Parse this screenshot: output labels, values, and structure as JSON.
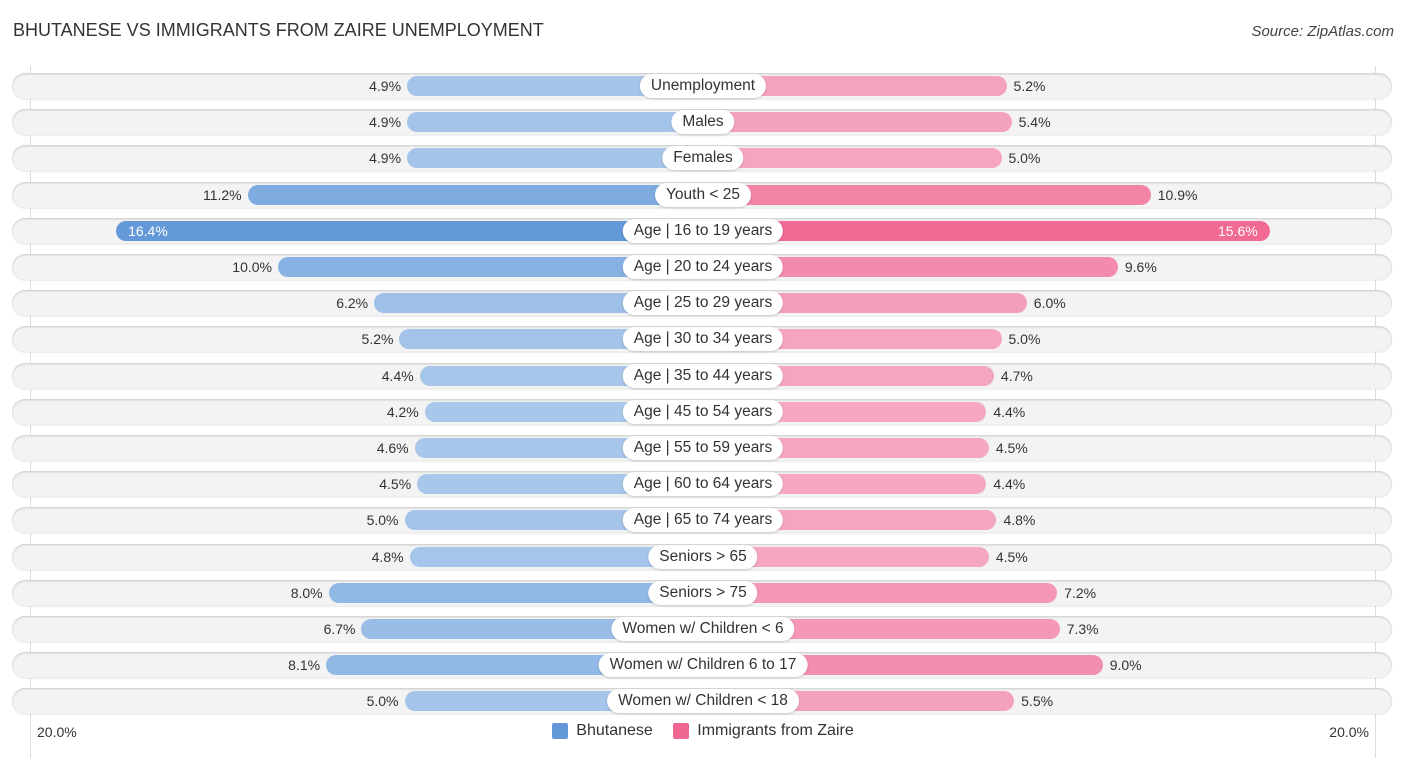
{
  "header": {
    "title": "BHUTANESE VS IMMIGRANTS FROM ZAIRE UNEMPLOYMENT",
    "source": "Source: ZipAtlas.com"
  },
  "colors": {
    "left_strong": "#6399d8",
    "left_light": "#aac8eb",
    "right_strong": "#f06892",
    "right_light": "#f5aac2"
  },
  "chart_data": {
    "type": "bar",
    "orientation": "horizontal-diverging",
    "title": "BHUTANESE VS IMMIGRANTS FROM ZAIRE UNEMPLOYMENT",
    "xlim": [
      0,
      20
    ],
    "axis_labels": {
      "left": "20.0%",
      "right": "20.0%"
    },
    "legend": {
      "position": "bottom-center",
      "entries": [
        "Bhutanese",
        "Immigrants from Zaire"
      ]
    },
    "categories": [
      "Unemployment",
      "Males",
      "Females",
      "Youth < 25",
      "Age | 16 to 19 years",
      "Age | 20 to 24 years",
      "Age | 25 to 29 years",
      "Age | 30 to 34 years",
      "Age | 35 to 44 years",
      "Age | 45 to 54 years",
      "Age | 55 to 59 years",
      "Age | 60 to 64 years",
      "Age | 65 to 74 years",
      "Seniors > 65",
      "Seniors > 75",
      "Women w/ Children < 6",
      "Women w/ Children 6 to 17",
      "Women w/ Children < 18"
    ],
    "series": [
      {
        "name": "Bhutanese",
        "values": [
          4.9,
          4.9,
          4.9,
          11.2,
          16.4,
          10.0,
          6.2,
          5.2,
          4.4,
          4.2,
          4.6,
          4.5,
          5.0,
          4.8,
          8.0,
          6.7,
          8.1,
          5.0
        ],
        "labels": [
          "4.9%",
          "4.9%",
          "4.9%",
          "11.2%",
          "16.4%",
          "10.0%",
          "6.2%",
          "5.2%",
          "4.4%",
          "4.2%",
          "4.6%",
          "4.5%",
          "5.0%",
          "4.8%",
          "8.0%",
          "6.7%",
          "8.1%",
          "5.0%"
        ]
      },
      {
        "name": "Immigrants from Zaire",
        "values": [
          5.2,
          5.4,
          5.0,
          10.9,
          15.6,
          9.6,
          6.0,
          5.0,
          4.7,
          4.4,
          4.5,
          4.4,
          4.8,
          4.5,
          7.2,
          7.3,
          9.0,
          5.5
        ],
        "labels": [
          "5.2%",
          "5.4%",
          "5.0%",
          "10.9%",
          "15.6%",
          "9.6%",
          "6.0%",
          "5.0%",
          "4.7%",
          "4.4%",
          "4.5%",
          "4.4%",
          "4.8%",
          "4.5%",
          "7.2%",
          "7.3%",
          "9.0%",
          "5.5%"
        ]
      }
    ]
  }
}
